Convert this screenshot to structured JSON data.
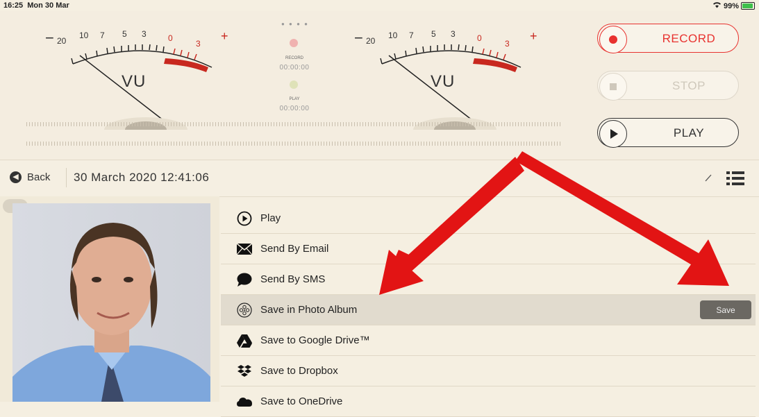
{
  "status_bar": {
    "time": "16:25",
    "date": "Mon 30 Mar",
    "battery_percent": "99%",
    "icons": [
      "wifi-icon",
      "battery-icon"
    ]
  },
  "vu_meter": {
    "scale_labels": [
      "20",
      "10",
      "7",
      "5",
      "3",
      "0",
      "3"
    ],
    "minus": "−",
    "plus": "+",
    "label": "VU"
  },
  "indicators": {
    "record_label": "RECORD",
    "record_time": "00:00:00",
    "play_label": "PLAY",
    "play_time": "00:00:00"
  },
  "controls": {
    "record_label": "RECORD",
    "stop_label": "STOP",
    "play_label": "PLAY"
  },
  "nav_bar": {
    "back_label": "Back",
    "title": "30 March 2020 12:41:06"
  },
  "menu": {
    "items": [
      {
        "label": "Play",
        "icon": "play-circle-icon"
      },
      {
        "label": "Send By Email",
        "icon": "envelope-icon"
      },
      {
        "label": "Send By SMS",
        "icon": "speech-bubble-icon"
      },
      {
        "label": "Save in Photo Album",
        "icon": "photo-album-icon",
        "action_label": "Save"
      },
      {
        "label": "Save to Google Drive™",
        "icon": "google-drive-icon"
      },
      {
        "label": "Save to Dropbox",
        "icon": "dropbox-icon"
      },
      {
        "label": "Save to OneDrive",
        "icon": "onedrive-icon"
      }
    ]
  },
  "colors": {
    "accent_red": "#e8322f",
    "background": "#f5efe1",
    "arrow_red": "#e21414"
  }
}
